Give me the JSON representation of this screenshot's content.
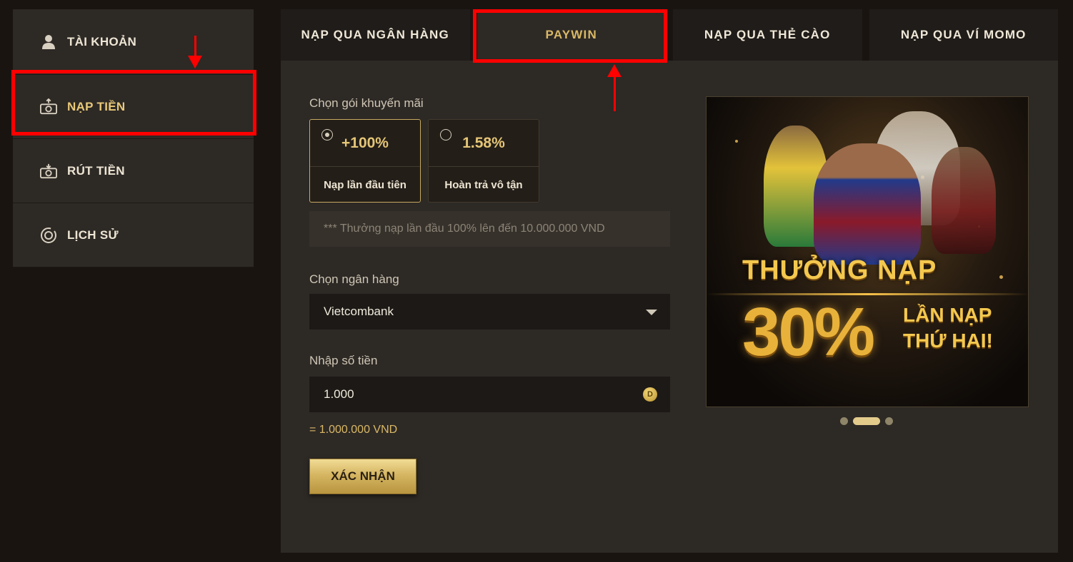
{
  "sidebar": {
    "items": [
      {
        "label": "TÀI KHOẢN",
        "icon": "user-icon"
      },
      {
        "label": "NẠP TIỀN",
        "icon": "deposit-icon"
      },
      {
        "label": "RÚT TIỀN",
        "icon": "withdraw-icon"
      },
      {
        "label": "LỊCH SỬ",
        "icon": "history-icon"
      }
    ]
  },
  "tabs": [
    {
      "label": "NẠP QUA NGÂN HÀNG"
    },
    {
      "label": "PAYWIN"
    },
    {
      "label": "NẠP QUA THẺ CÀO"
    },
    {
      "label": "NẠP QUA VÍ MOMO"
    }
  ],
  "form": {
    "promo_label": "Chọn gói khuyến mãi",
    "promos": [
      {
        "value": "+100%",
        "name": "Nạp lần đầu tiên"
      },
      {
        "value": "1.58%",
        "name": "Hoàn trả vô tận"
      }
    ],
    "note": "*** Thưởng nạp lần đầu 100% lên đến 10.000.000 VND",
    "bank_label": "Chọn ngân hàng",
    "bank_value": "Vietcombank",
    "amount_label": "Nhập số tiền",
    "amount_value": "1.000",
    "coin_symbol": "D",
    "converted": "= 1.000.000 VND",
    "confirm_label": "XÁC NHẬN"
  },
  "banner": {
    "headline": "THƯỞNG NẠP",
    "big": "30%",
    "line1": "LẦN NẠP",
    "line2": "THỨ HAI!"
  },
  "colors": {
    "accent_gold": "#d9b866",
    "annotation_red": "#ff0000"
  }
}
